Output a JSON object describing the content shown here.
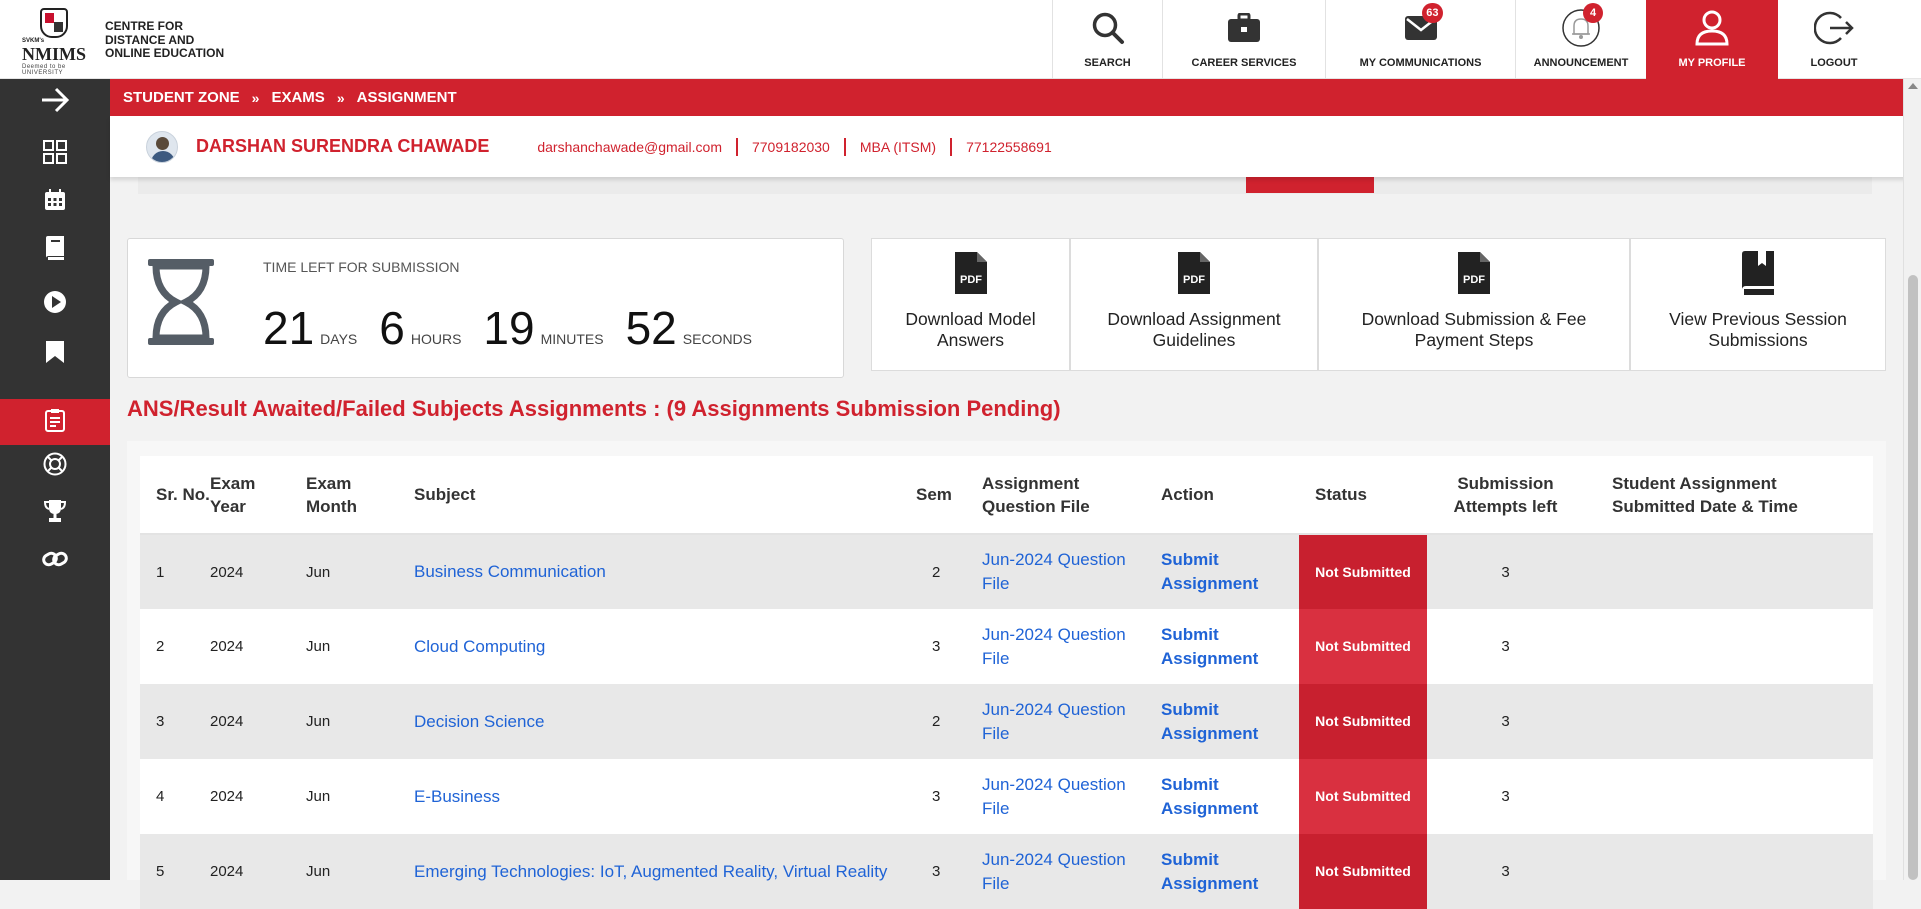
{
  "header": {
    "logo": {
      "prefix": "SVKM's",
      "name": "NMIMS",
      "sub": "Deemed to be UNIVERSITY"
    },
    "centre_title": [
      "CENTRE FOR",
      "DISTANCE AND",
      "ONLINE EDUCATION"
    ],
    "nav": [
      {
        "label": "SEARCH",
        "icon": "search-icon"
      },
      {
        "label": "CAREER SERVICES",
        "icon": "briefcase-icon"
      },
      {
        "label": "MY COMMUNICATIONS",
        "icon": "envelope-icon",
        "badge": "63"
      },
      {
        "label": "ANNOUNCEMENT",
        "icon": "bell-icon",
        "badge": "4"
      },
      {
        "label": "MY PROFILE",
        "icon": "user-icon",
        "active": true
      },
      {
        "label": "LOGOUT",
        "icon": "logout-icon"
      }
    ]
  },
  "sidebar": {
    "items": [
      {
        "icon": "arrow-right-icon"
      },
      {
        "icon": "grid-icon"
      },
      {
        "icon": "calendar-icon"
      },
      {
        "icon": "book-icon"
      },
      {
        "icon": "play-icon"
      },
      {
        "icon": "bookmark-icon"
      },
      {
        "icon": "clipboard-icon",
        "active": true
      },
      {
        "icon": "lifebuoy-icon"
      },
      {
        "icon": "trophy-icon"
      },
      {
        "icon": "link-icon"
      }
    ]
  },
  "breadcrumb": [
    "STUDENT ZONE",
    "EXAMS",
    "ASSIGNMENT"
  ],
  "student": {
    "name": "DARSHAN SURENDRA CHAWADE",
    "email": "darshanchawade@gmail.com",
    "phone": "7709182030",
    "program": "MBA (ITSM)",
    "sapid": "77122558691"
  },
  "timer": {
    "label": "TIME LEFT FOR SUBMISSION",
    "days": "21",
    "days_unit": "DAYS",
    "hours": "6",
    "hours_unit": "HOURS",
    "minutes": "19",
    "minutes_unit": "MINUTES",
    "seconds": "52",
    "seconds_unit": "SECONDS"
  },
  "downloads": [
    {
      "label": "Download Model Answers",
      "icon": "pdf-icon"
    },
    {
      "label": "Download Assignment Guidelines",
      "icon": "pdf-icon"
    },
    {
      "label": "Download Submission & Fee Payment Steps",
      "icon": "pdf-icon"
    },
    {
      "label": "View Previous Session Submissions",
      "icon": "book-icon"
    }
  ],
  "section_title": "ANS/Result Awaited/Failed Subjects Assignments : (9 Assignments Submission Pending)",
  "table": {
    "headers": [
      "Sr. No.",
      "Exam Year",
      "Exam Month",
      "Subject",
      "Sem",
      "Assignment Question File",
      "Action",
      "Status",
      "Submission Attempts left",
      "Student Assignment Submitted Date & Time"
    ],
    "rows": [
      {
        "sr": "1",
        "year": "2024",
        "month": "Jun",
        "subject": "Business Communication",
        "sem": "2",
        "qfile": "Jun-2024 Question File",
        "action": "Submit Assignment",
        "status": "Not Submitted",
        "attempts": "3",
        "submitted": ""
      },
      {
        "sr": "2",
        "year": "2024",
        "month": "Jun",
        "subject": "Cloud Computing",
        "sem": "3",
        "qfile": "Jun-2024 Question File",
        "action": "Submit Assignment",
        "status": "Not Submitted",
        "attempts": "3",
        "submitted": ""
      },
      {
        "sr": "3",
        "year": "2024",
        "month": "Jun",
        "subject": "Decision Science",
        "sem": "2",
        "qfile": "Jun-2024 Question File",
        "action": "Submit Assignment",
        "status": "Not Submitted",
        "attempts": "3",
        "submitted": ""
      },
      {
        "sr": "4",
        "year": "2024",
        "month": "Jun",
        "subject": "E-Business",
        "sem": "3",
        "qfile": "Jun-2024 Question File",
        "action": "Submit Assignment",
        "status": "Not Submitted",
        "attempts": "3",
        "submitted": ""
      },
      {
        "sr": "5",
        "year": "2024",
        "month": "Jun",
        "subject": "Emerging Technologies: IoT, Augmented Reality, Virtual Reality",
        "sem": "3",
        "qfile": "Jun-2024 Question File",
        "action": "Submit Assignment",
        "status": "Not Submitted",
        "attempts": "3",
        "submitted": ""
      }
    ]
  },
  "colors": {
    "brand_red": "#d0222e",
    "sidebar": "#333333",
    "link_blue": "#1f63d6"
  }
}
